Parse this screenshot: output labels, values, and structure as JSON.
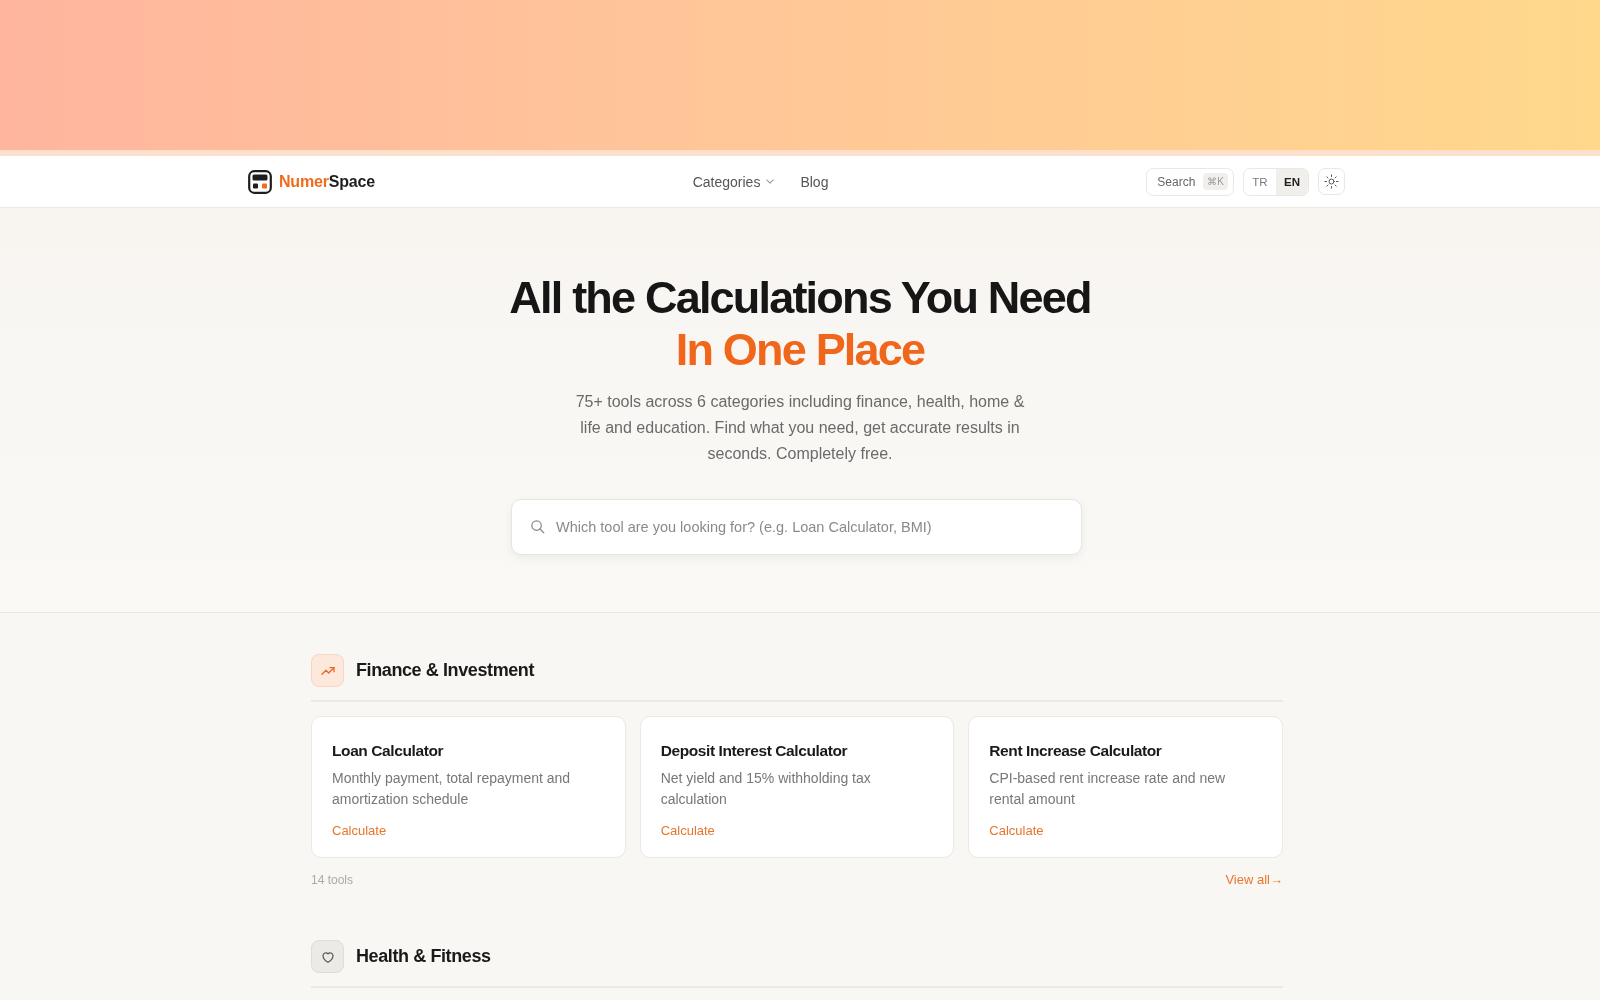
{
  "nav": {
    "brand": {
      "first": "Numer",
      "second": "Space"
    },
    "links": [
      {
        "label": "Categories",
        "dropdown": true
      },
      {
        "label": "Blog",
        "dropdown": false
      }
    ],
    "search": {
      "label": "Search",
      "shortcut": "⌘K"
    },
    "languages": [
      {
        "label": "TR",
        "selected": false
      },
      {
        "label": "EN",
        "selected": true
      }
    ]
  },
  "hero": {
    "title": "All the Calculations You Need",
    "highlight": "In One Place",
    "description": "75+ tools across 6 categories including finance, health, home & life and education. Find what you need, get accurate results in seconds. Completely free.",
    "search": {
      "placeholder": "Which tool are you looking for? (e.g. Loan Calculator, BMI)"
    }
  },
  "categories": [
    {
      "title": "Finance & Investment",
      "kind": "finance",
      "tools": [
        {
          "title": "Loan Calculator",
          "description": "Monthly payment, total repayment and amortization schedule",
          "action": "Calculate"
        },
        {
          "title": "Deposit Interest Calculator",
          "description": "Net yield and 15% withholding tax calculation",
          "action": "Calculate"
        },
        {
          "title": "Rent Increase Calculator",
          "description": "CPI-based rent increase rate and new rental amount",
          "action": "Calculate"
        }
      ],
      "count": "14 tools",
      "view_all": "View all→"
    },
    {
      "title": "Health & Fitness",
      "kind": "health"
    }
  ]
}
